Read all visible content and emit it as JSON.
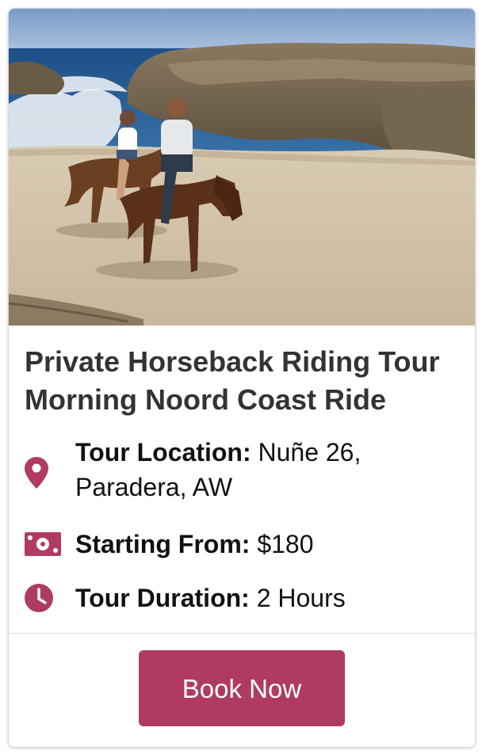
{
  "tour": {
    "title": "Private Horseback Riding Tour Morning Noord Coast Ride",
    "location_label": "Tour Location:",
    "location_value": "Nuñe 26, Paradera, AW",
    "price_label": "Starting From:",
    "price_value": "$180",
    "duration_label": "Tour Duration:",
    "duration_value": "2 Hours",
    "book_label": "Book Now"
  },
  "icons": {
    "location": "map-marker-icon",
    "price": "money-bill-icon",
    "duration": "clock-icon"
  },
  "colors": {
    "accent": "#b03b62",
    "title": "#333333",
    "text": "#111111"
  }
}
